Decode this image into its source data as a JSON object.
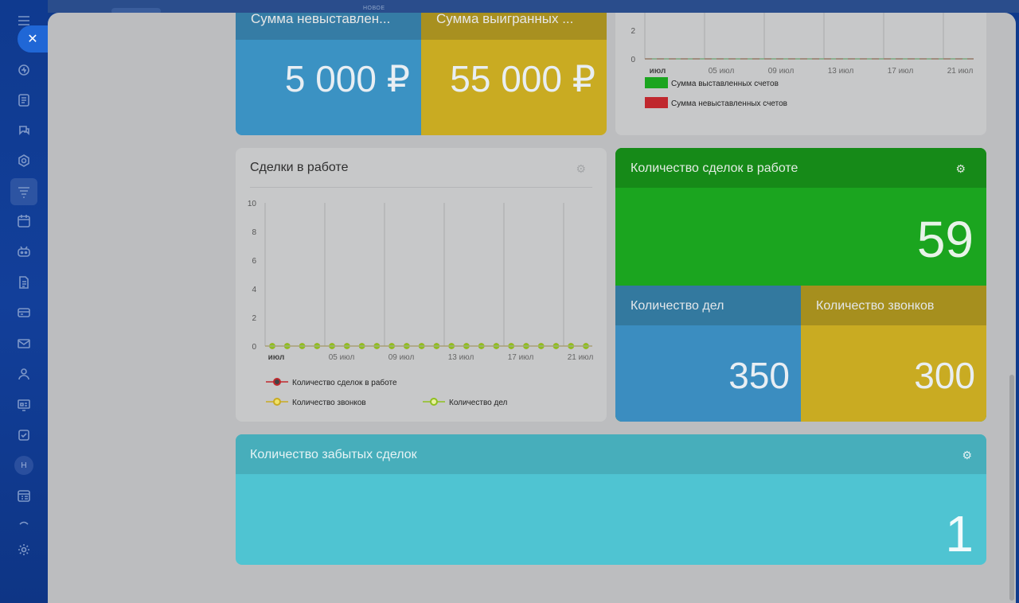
{
  "top_banner": {
    "tag": "НОВОЕ"
  },
  "sidebar": {
    "close_label": "✕",
    "avatar_letter": "Н",
    "items": [
      {
        "icon": "menu-icon"
      },
      {
        "icon": "pulse-icon"
      },
      {
        "icon": "feed-icon"
      },
      {
        "icon": "chat-icon"
      },
      {
        "icon": "hexagon-icon"
      },
      {
        "icon": "crm-funnel-icon"
      },
      {
        "icon": "calendar-icon"
      },
      {
        "icon": "robot-icon"
      },
      {
        "icon": "document-icon"
      },
      {
        "icon": "card-icon"
      },
      {
        "icon": "mail-icon"
      },
      {
        "icon": "users-icon"
      },
      {
        "icon": "presentation-icon"
      },
      {
        "icon": "task-check-icon"
      },
      {
        "icon": "schedule-icon"
      },
      {
        "icon": "chevron-up-icon"
      },
      {
        "icon": "settings-gear-icon"
      }
    ]
  },
  "widgets": {
    "sums": {
      "left_title": "Сумма невыставлен...",
      "left_value": "5 000 ₽",
      "right_title": "Сумма выигранных ...",
      "right_value": "55 000 ₽",
      "left_color": "#3b92c3",
      "right_color": "#c9ab22"
    },
    "invoices_chart": {
      "legend": [
        "Сумма выставленных счетов",
        "Сумма невыставленных счетов"
      ]
    },
    "deals_chart": {
      "title": "Сделки в работе",
      "legend": [
        "Количество сделок в работе",
        "Количество звонков",
        "Количество дел"
      ]
    },
    "deals_count": {
      "title": "Количество сделок в работе",
      "value": "59",
      "activities_title": "Количество дел",
      "activities_value": "350",
      "calls_title": "Количество звонков",
      "calls_value": "300",
      "color": "#1ba51f"
    },
    "forgotten": {
      "title": "Количество забытых сделок",
      "value": "1",
      "color": "#4fc4d2"
    }
  },
  "chart_data": [
    {
      "type": "line",
      "x": [
        "июл",
        "05 июл",
        "09 июл",
        "13 июл",
        "17 июл",
        "21 июл"
      ],
      "yticks": [
        0,
        2
      ],
      "series": [
        {
          "name": "Сумма выставленных счетов",
          "color": "#1ba51f",
          "values": [
            0,
            0,
            0,
            0,
            0,
            0
          ]
        },
        {
          "name": "Сумма невыставленных счетов",
          "color": "#c0282e",
          "values": [
            0,
            0,
            0,
            0,
            0,
            0
          ]
        }
      ],
      "legend": "bottom"
    },
    {
      "type": "line",
      "title": "Сделки в работе",
      "x": [
        "июл",
        "05 июл",
        "09 июл",
        "13 июл",
        "17 июл",
        "21 июл"
      ],
      "ylim": [
        0,
        10
      ],
      "yticks": [
        0,
        2,
        4,
        6,
        8,
        10
      ],
      "points": 22,
      "series": [
        {
          "name": "Количество сделок в работе",
          "color": "#c0282e",
          "values": [
            0,
            0,
            0,
            0,
            0,
            0,
            0,
            0,
            0,
            0,
            0,
            0,
            0,
            0,
            0,
            0,
            0,
            0,
            0,
            0,
            0,
            0
          ]
        },
        {
          "name": "Количество звонков",
          "color": "#c9ab22",
          "values": [
            0,
            0,
            0,
            0,
            0,
            0,
            0,
            0,
            0,
            0,
            0,
            0,
            0,
            0,
            0,
            0,
            0,
            0,
            0,
            0,
            0,
            0
          ]
        },
        {
          "name": "Количество дел",
          "color": "#8fbf1f",
          "values": [
            0,
            0,
            0,
            0,
            0,
            0,
            0,
            0,
            0,
            0,
            0,
            0,
            0,
            0,
            0,
            0,
            0,
            0,
            0,
            0,
            0,
            0
          ]
        }
      ],
      "legend": "bottom"
    }
  ]
}
